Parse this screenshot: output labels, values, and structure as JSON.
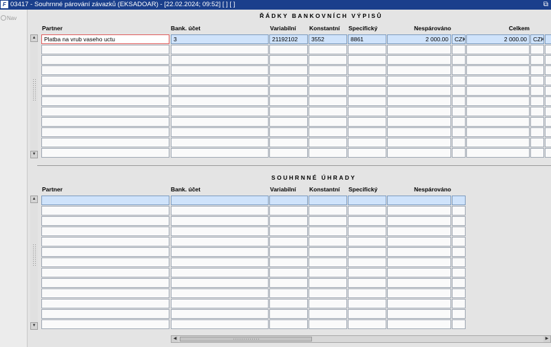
{
  "window": {
    "title": "03417 - Souhrnné párování závazků (EKSADOAR) - [22.02.2024; 09:52]  [ ] [ ]",
    "app_icon": "F",
    "restore_icon": "window-restore-icon"
  },
  "nav": {
    "label": "Nav"
  },
  "bank_rows": {
    "title": "ŘÁDKY BANKOVNÍCH VÝPISŮ",
    "headers": {
      "partner": "Partner",
      "account": "Bank. účet",
      "variable": "Variabilní",
      "constant": "Konstantní",
      "specific": "Specifický",
      "unmatched": "Nespárováno",
      "total": "Celkem"
    },
    "rows": [
      {
        "partner": "Platba na vrub vaseho uctu",
        "account": "3",
        "variable": "21192102",
        "constant": "3552",
        "specific": "8861",
        "unmatched": "2 000.00",
        "unmatched_currency": "CZK",
        "total": "2 000.00",
        "total_currency": "CZK"
      }
    ],
    "empty_rows": 11
  },
  "summary": {
    "title": "SOUHRNNÉ ÚHRADY",
    "headers": {
      "partner": "Partner",
      "account": "Bank. účet",
      "variable": "Variabilní",
      "constant": "Konstantní",
      "specific": "Specifický",
      "unmatched": "Nespárováno"
    },
    "rows": [],
    "empty_rows": 13
  }
}
